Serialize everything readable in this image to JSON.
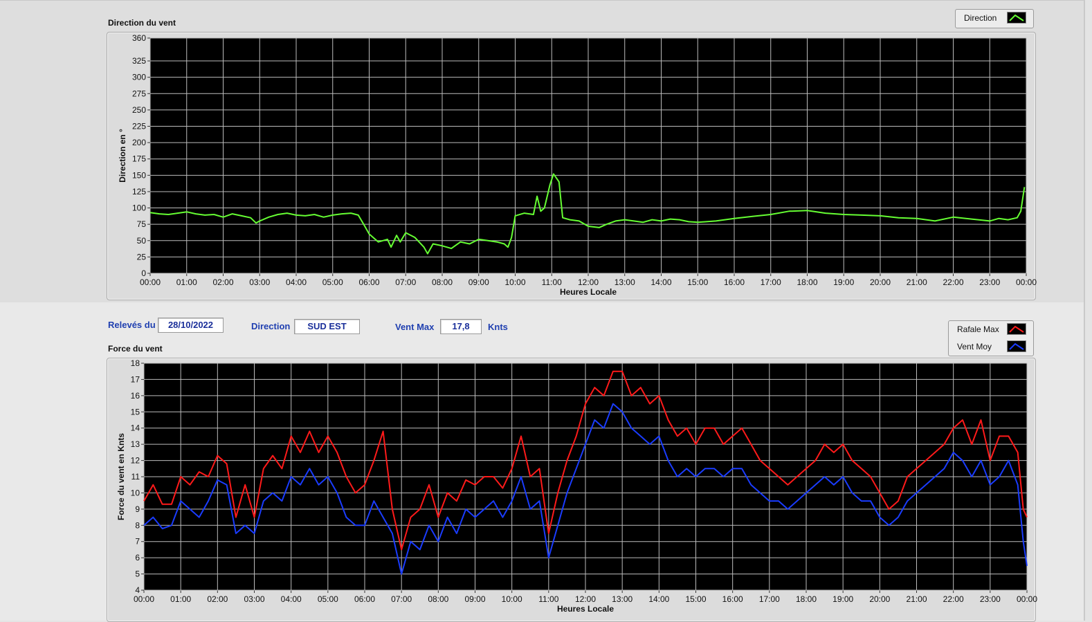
{
  "direction_panel": {
    "title": "Direction du vent"
  },
  "force_panel": {
    "title": "Force du vent"
  },
  "fields": {
    "releves_label": "Relevés du",
    "releves_value": "28/10/2022",
    "direction_label": "Direction",
    "direction_value": "SUD EST",
    "ventmax_label": "Vent Max",
    "ventmax_value": "17,8",
    "ventmax_unit": "Knts"
  },
  "colors": {
    "direction": "#66ff33",
    "rafale": "#ff1a1a",
    "moy": "#1a3cff",
    "plot_bg": "#000000",
    "grid": "#bdbdbd"
  },
  "chart_data": [
    {
      "type": "line",
      "xlabel": "Heures Locale",
      "ylabel": "Direction en °",
      "ylim": [
        0,
        360
      ],
      "xlim": [
        0,
        24
      ],
      "yticks": [
        0,
        25,
        50,
        75,
        100,
        125,
        150,
        175,
        200,
        225,
        250,
        275,
        300,
        325,
        360
      ],
      "xticks": [
        "00:00",
        "01:00",
        "02:00",
        "03:00",
        "04:00",
        "05:00",
        "06:00",
        "07:00",
        "08:00",
        "09:00",
        "10:00",
        "11:00",
        "12:00",
        "13:00",
        "14:00",
        "15:00",
        "16:00",
        "17:00",
        "18:00",
        "19:00",
        "20:00",
        "21:00",
        "22:00",
        "23:00",
        "00:00"
      ],
      "grid": true,
      "legend_position": "top-right",
      "series": [
        {
          "name": "Direction",
          "color": "#66ff33",
          "x": [
            0,
            0.25,
            0.5,
            0.75,
            1.0,
            1.25,
            1.5,
            1.75,
            2.0,
            2.25,
            2.5,
            2.75,
            2.9,
            3.0,
            3.25,
            3.5,
            3.75,
            4.0,
            4.25,
            4.5,
            4.75,
            5.0,
            5.25,
            5.5,
            5.7,
            5.85,
            6.0,
            6.25,
            6.5,
            6.6,
            6.75,
            6.85,
            7.0,
            7.25,
            7.5,
            7.6,
            7.75,
            8.0,
            8.25,
            8.5,
            8.75,
            9.0,
            9.25,
            9.5,
            9.7,
            9.8,
            9.9,
            10.0,
            10.25,
            10.5,
            10.6,
            10.7,
            10.8,
            10.95,
            11.05,
            11.2,
            11.3,
            11.5,
            11.75,
            12.0,
            12.3,
            12.5,
            12.75,
            13.0,
            13.25,
            13.5,
            13.75,
            14.0,
            14.25,
            14.5,
            14.75,
            15.0,
            15.5,
            16.0,
            16.5,
            17.0,
            17.5,
            18.0,
            18.5,
            19.0,
            19.5,
            20.0,
            20.5,
            21.0,
            21.5,
            22.0,
            22.5,
            23.0,
            23.25,
            23.5,
            23.75,
            23.85,
            23.95
          ],
          "y": [
            93,
            91,
            90,
            92,
            94,
            91,
            89,
            90,
            86,
            91,
            88,
            85,
            77,
            80,
            86,
            90,
            92,
            89,
            88,
            90,
            86,
            89,
            91,
            92,
            89,
            75,
            60,
            48,
            52,
            40,
            58,
            48,
            62,
            55,
            40,
            30,
            45,
            42,
            38,
            48,
            45,
            52,
            50,
            48,
            45,
            40,
            55,
            88,
            92,
            90,
            118,
            95,
            100,
            135,
            152,
            140,
            85,
            82,
            80,
            72,
            70,
            75,
            80,
            82,
            80,
            78,
            82,
            80,
            83,
            82,
            79,
            78,
            80,
            84,
            87,
            90,
            95,
            96,
            92,
            90,
            89,
            88,
            85,
            84,
            80,
            86,
            83,
            80,
            84,
            82,
            85,
            95,
            132
          ]
        }
      ]
    },
    {
      "type": "line",
      "xlabel": "Heures Locale",
      "ylabel": "Force du vent en Knts",
      "ylim": [
        4,
        18
      ],
      "xlim": [
        0,
        24
      ],
      "yticks": [
        4,
        5,
        6,
        7,
        8,
        9,
        10,
        11,
        12,
        13,
        14,
        15,
        16,
        17,
        18
      ],
      "xticks": [
        "00:00",
        "01:00",
        "02:00",
        "03:00",
        "04:00",
        "05:00",
        "06:00",
        "07:00",
        "08:00",
        "09:00",
        "10:00",
        "11:00",
        "12:00",
        "13:00",
        "14:00",
        "15:00",
        "16:00",
        "17:00",
        "18:00",
        "19:00",
        "20:00",
        "21:00",
        "22:00",
        "23:00",
        "00:00"
      ],
      "grid": true,
      "legend_position": "top-right",
      "series": [
        {
          "name": "Rafale Max",
          "color": "#ff1a1a",
          "x": [
            0,
            0.25,
            0.5,
            0.75,
            1.0,
            1.25,
            1.5,
            1.75,
            2.0,
            2.25,
            2.5,
            2.75,
            3.0,
            3.25,
            3.5,
            3.75,
            4.0,
            4.25,
            4.5,
            4.75,
            5.0,
            5.25,
            5.5,
            5.75,
            6.0,
            6.25,
            6.5,
            6.75,
            7.0,
            7.25,
            7.5,
            7.75,
            8.0,
            8.25,
            8.5,
            8.75,
            9.0,
            9.25,
            9.5,
            9.75,
            10.0,
            10.25,
            10.5,
            10.75,
            11.0,
            11.25,
            11.5,
            11.75,
            12.0,
            12.25,
            12.5,
            12.75,
            13.0,
            13.25,
            13.5,
            13.75,
            14.0,
            14.25,
            14.5,
            14.75,
            15.0,
            15.25,
            15.5,
            15.75,
            16.0,
            16.25,
            16.5,
            16.75,
            17.0,
            17.25,
            17.5,
            17.75,
            18.0,
            18.25,
            18.5,
            18.75,
            19.0,
            19.25,
            19.5,
            19.75,
            20.0,
            20.25,
            20.5,
            20.75,
            21.0,
            21.25,
            21.5,
            21.75,
            22.0,
            22.25,
            22.5,
            22.75,
            23.0,
            23.25,
            23.5,
            23.75,
            23.9,
            24.0
          ],
          "y": [
            9.5,
            10.5,
            9.3,
            9.3,
            11.0,
            10.5,
            11.3,
            11.0,
            12.3,
            11.8,
            8.5,
            10.5,
            8.5,
            11.5,
            12.3,
            11.5,
            13.5,
            12.5,
            13.8,
            12.5,
            13.5,
            12.5,
            11.0,
            10.0,
            10.5,
            12.0,
            13.8,
            9.0,
            6.5,
            8.5,
            9.0,
            10.5,
            8.5,
            10.0,
            9.5,
            10.8,
            10.5,
            11.0,
            11.0,
            10.3,
            11.5,
            13.5,
            11.0,
            11.5,
            7.5,
            10.0,
            12.0,
            13.5,
            15.5,
            16.5,
            16.0,
            17.5,
            17.5,
            16.0,
            16.5,
            15.5,
            16.0,
            14.5,
            13.5,
            14.0,
            13.0,
            14.0,
            14.0,
            13.0,
            13.5,
            14.0,
            13.0,
            12.0,
            11.5,
            11.0,
            10.5,
            11.0,
            11.5,
            12.0,
            13.0,
            12.5,
            13.0,
            12.0,
            11.5,
            11.0,
            10.0,
            9.0,
            9.5,
            11.0,
            11.5,
            12.0,
            12.5,
            13.0,
            14.0,
            14.5,
            13.0,
            14.5,
            12.0,
            13.5,
            13.5,
            12.5,
            9.0,
            8.5
          ]
        },
        {
          "name": "Vent Moy",
          "color": "#1a3cff",
          "x": [
            0,
            0.25,
            0.5,
            0.75,
            1.0,
            1.25,
            1.5,
            1.75,
            2.0,
            2.25,
            2.5,
            2.75,
            3.0,
            3.25,
            3.5,
            3.75,
            4.0,
            4.25,
            4.5,
            4.75,
            5.0,
            5.25,
            5.5,
            5.75,
            6.0,
            6.25,
            6.5,
            6.75,
            7.0,
            7.25,
            7.5,
            7.75,
            8.0,
            8.25,
            8.5,
            8.75,
            9.0,
            9.25,
            9.5,
            9.75,
            10.0,
            10.25,
            10.5,
            10.75,
            11.0,
            11.25,
            11.5,
            11.75,
            12.0,
            12.25,
            12.5,
            12.75,
            13.0,
            13.25,
            13.5,
            13.75,
            14.0,
            14.25,
            14.5,
            14.75,
            15.0,
            15.25,
            15.5,
            15.75,
            16.0,
            16.25,
            16.5,
            16.75,
            17.0,
            17.25,
            17.5,
            17.75,
            18.0,
            18.25,
            18.5,
            18.75,
            19.0,
            19.25,
            19.5,
            19.75,
            20.0,
            20.25,
            20.5,
            20.75,
            21.0,
            21.25,
            21.5,
            21.75,
            22.0,
            22.25,
            22.5,
            22.75,
            23.0,
            23.25,
            23.5,
            23.75,
            23.9,
            24.0
          ],
          "y": [
            8.0,
            8.5,
            7.8,
            8.0,
            9.5,
            9.0,
            8.5,
            9.5,
            10.8,
            10.5,
            7.5,
            8.0,
            7.5,
            9.5,
            10.0,
            9.5,
            11.0,
            10.5,
            11.5,
            10.5,
            11.0,
            10.0,
            8.5,
            8.0,
            8.0,
            9.5,
            8.5,
            7.5,
            5.0,
            7.0,
            6.5,
            8.0,
            7.0,
            8.5,
            7.5,
            9.0,
            8.5,
            9.0,
            9.5,
            8.5,
            9.5,
            11.0,
            9.0,
            9.5,
            6.0,
            8.0,
            10.0,
            11.5,
            13.0,
            14.5,
            14.0,
            15.5,
            15.0,
            14.0,
            13.5,
            13.0,
            13.5,
            12.0,
            11.0,
            11.5,
            11.0,
            11.5,
            11.5,
            11.0,
            11.5,
            11.5,
            10.5,
            10.0,
            9.5,
            9.5,
            9.0,
            9.5,
            10.0,
            10.5,
            11.0,
            10.5,
            11.0,
            10.0,
            9.5,
            9.5,
            8.5,
            8.0,
            8.5,
            9.5,
            10.0,
            10.5,
            11.0,
            11.5,
            12.5,
            12.0,
            11.0,
            12.0,
            10.5,
            11.0,
            12.0,
            10.5,
            7.0,
            5.5
          ]
        }
      ]
    }
  ]
}
